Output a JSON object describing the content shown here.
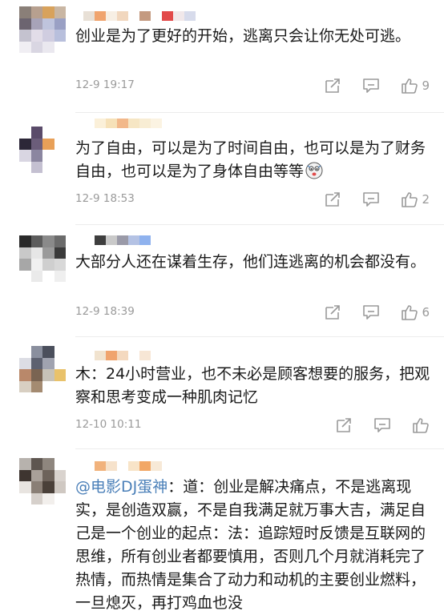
{
  "comments": [
    {
      "text": "创业是为了更好的开始，逃离只会让你无处可逃。",
      "time": "12-9 19:17",
      "likes": "9"
    },
    {
      "text": "为了自由，可以是为了时间自由，也可以是为了财务自由，也可以是为了身体自由等等",
      "time": "12-9 18:53",
      "likes": "2"
    },
    {
      "text": "大部分人还在谋着生存，他们连逃离的机会都没有。",
      "time": "12-9 18:39",
      "likes": "6"
    },
    {
      "text": "木：24小时营业，也不未必是顾客想要的服务，把观察和思考变成一种肌肉记忆",
      "time": "12-10 10:11",
      "likes": ""
    },
    {
      "mention": "@电影DJ蛋神",
      "text": "：道：创业是解决痛点，不是逃离现实，是创造双赢，不是自我满足就万事大吉，满足自己是一个创业的起点：法：追踪短时反馈是互联网的思维，所有创业者都要慎用，否则几个月就消耗完了热情，而热情是集合了动力和动机的主要创业燃料，一旦熄灭，再打鸡血也没"
    }
  ],
  "icon_color": "#9a9a9a",
  "mention_color": "#4a7fb8"
}
